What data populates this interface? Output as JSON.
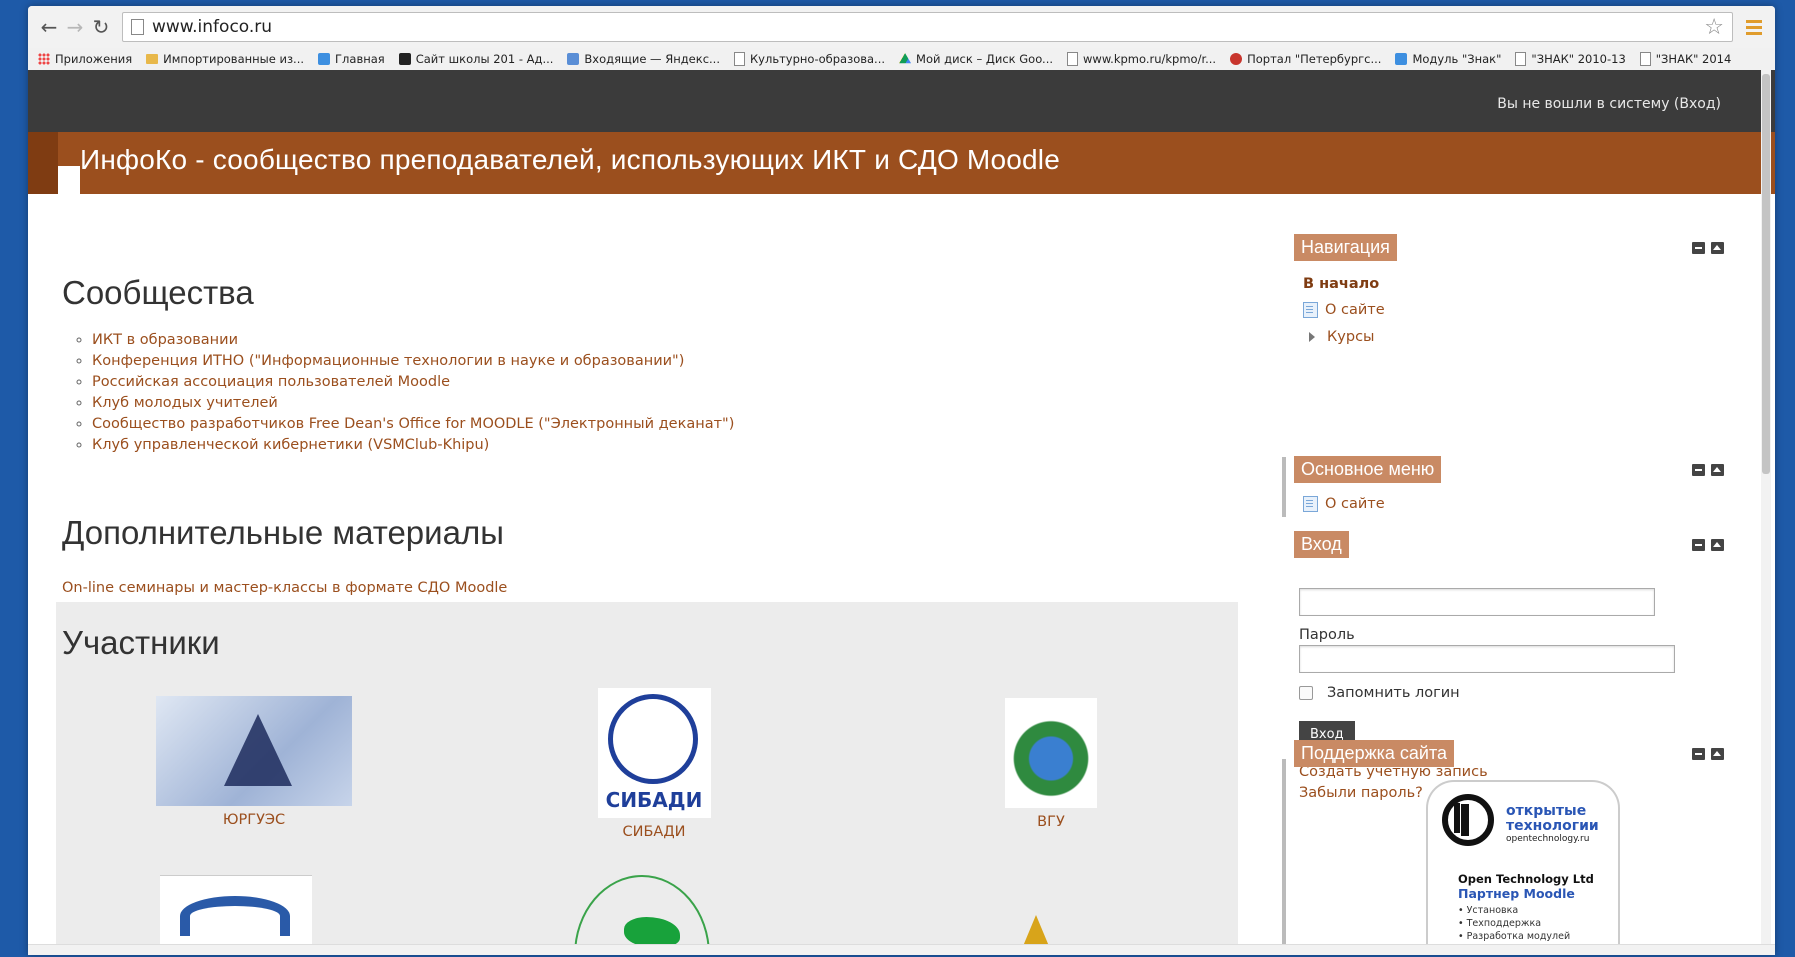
{
  "browser": {
    "url": "www.infoco.ru",
    "bookmarks": [
      {
        "label": "Приложения",
        "icon": "apps-icon"
      },
      {
        "label": "Импортированные из...",
        "icon": "folder-icon"
      },
      {
        "label": "Главная",
        "icon": "pen-icon"
      },
      {
        "label": "Сайт школы 201 - Ад...",
        "icon": "school-icon"
      },
      {
        "label": "Входящие — Яндекс...",
        "icon": "mail-icon"
      },
      {
        "label": "Культурно-образова...",
        "icon": "page-icon"
      },
      {
        "label": "Мой диск – Диск Goo...",
        "icon": "drive-icon"
      },
      {
        "label": "www.kpmo.ru/kpmo/r...",
        "icon": "page-icon"
      },
      {
        "label": "Портал \"Петербургс...",
        "icon": "emblem-icon"
      },
      {
        "label": "Модуль \"Знак\"",
        "icon": "module-icon"
      },
      {
        "label": "\"ЗНАК\" 2010-13",
        "icon": "page-icon"
      },
      {
        "label": "\"ЗНАК\" 2014",
        "icon": "page-icon"
      }
    ]
  },
  "site": {
    "login_status": "Вы не вошли в систему (Вход)",
    "title": "ИнфоКо - сообщество преподавателей, использующих ИКТ и СДО Moodle"
  },
  "main": {
    "communities_heading": "Сообщества",
    "communities": [
      "ИКТ в образовании",
      "Конференция ИТНО (\"Информационные технологии в науке и образовании\")",
      "Российская ассоциация пользователей Moodle",
      "Клуб молодых учителей",
      "Сообщество разработчиков Free Dean's Office for MOODLE (\"Электронный деканат\")",
      "Клуб управленческой кибернетики (VSMClub-Khipu)"
    ],
    "extra_heading": "Дополнительные материалы",
    "extra_link": "On-line семинары и мастер-классы в формате СДО Moodle",
    "participants_heading": "Участники",
    "participants": [
      {
        "name": "ЮРГУЭС",
        "logo_text": "ЮРГУЭС"
      },
      {
        "name": "СИБАДИ",
        "logo_text": "СИБАДИ"
      },
      {
        "name": "ВГУ",
        "logo_text": ""
      }
    ]
  },
  "sidebar": {
    "navigation": {
      "title": "Навигация",
      "home": "В начало",
      "items": [
        {
          "label": "О сайте",
          "icon": "page-icon"
        },
        {
          "label": "Курсы",
          "icon": "caret-right-icon"
        }
      ]
    },
    "main_menu": {
      "title": "Основное меню",
      "items": [
        {
          "label": "О сайте",
          "icon": "page-icon"
        }
      ]
    },
    "login": {
      "title": "Вход",
      "username_value": "",
      "password_label": "Пароль",
      "password_value": "",
      "remember_label": "Запомнить логин",
      "button_label": "Вход",
      "create_account": "Создать учетную запись",
      "forgot_password": "Забыли пароль?"
    },
    "support": {
      "title": "Поддержка сайта",
      "logo_title": "открытые технологии",
      "logo_domain": "opentechnology.ru",
      "company": "Open Technology Ltd",
      "partner": "Партнер Moodle",
      "services": [
        "• Установка",
        "• Техподдержка",
        "• Разработка модулей"
      ]
    }
  },
  "colors": {
    "accent": "#9b4f1e",
    "topbar": "#3b3b3b",
    "block_title": "#c98a64"
  }
}
